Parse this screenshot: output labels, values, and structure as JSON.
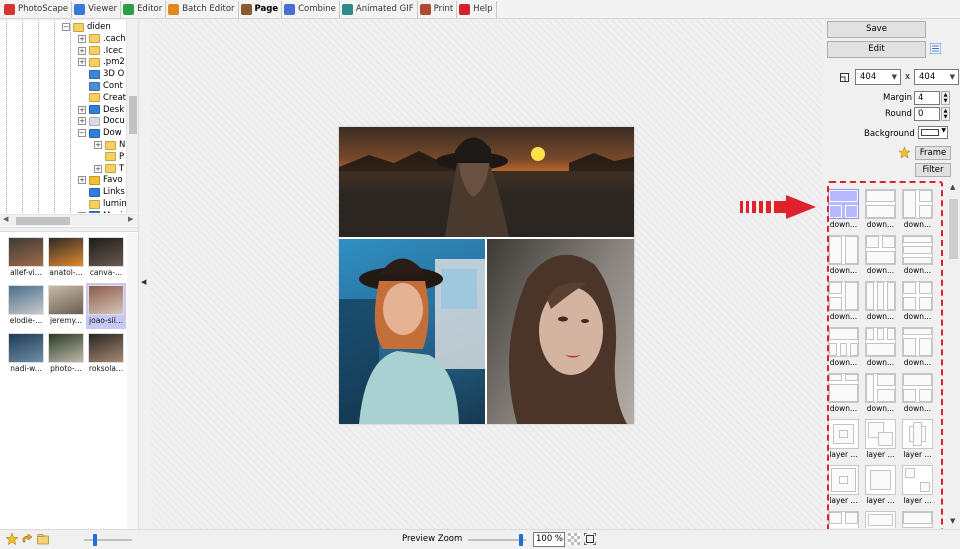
{
  "tabs": [
    {
      "label": "PhotoScape",
      "icon": "photoscape-icon",
      "color": "#d9342b"
    },
    {
      "label": "Viewer",
      "icon": "viewer-icon",
      "color": "#3a7ad6"
    },
    {
      "label": "Editor",
      "icon": "editor-icon",
      "color": "#2e9e45"
    },
    {
      "label": "Batch Editor",
      "icon": "batch-editor-icon",
      "color": "#e08a1e"
    },
    {
      "label": "Page",
      "icon": "page-icon",
      "color": "#8a5a2b",
      "active": true
    },
    {
      "label": "Combine",
      "icon": "combine-icon",
      "color": "#4a6fd1"
    },
    {
      "label": "Animated GIF",
      "icon": "animated-gif-icon",
      "color": "#2b8a8a"
    },
    {
      "label": "Print",
      "icon": "print-icon",
      "color": "#b04a2e"
    },
    {
      "label": "Help",
      "icon": "help-icon",
      "color": "#d3222a"
    }
  ],
  "tree": [
    {
      "label": "diden",
      "expander": "-",
      "indent": 1,
      "icon": "folder-icon",
      "color": "#f6cf5c"
    },
    {
      "label": ".cach",
      "expander": "+",
      "indent": 2,
      "icon": "folder-icon",
      "color": "#f6cf5c"
    },
    {
      "label": ".Icec",
      "expander": "+",
      "indent": 2,
      "icon": "folder-icon",
      "color": "#f6cf5c"
    },
    {
      "label": ".pm2",
      "expander": "+",
      "indent": 2,
      "icon": "folder-icon",
      "color": "#f6cf5c"
    },
    {
      "label": "3D O",
      "expander": "",
      "indent": 2,
      "icon": "3d-objects-icon",
      "color": "#3a86d8"
    },
    {
      "label": "Cont",
      "expander": "",
      "indent": 2,
      "icon": "contacts-icon",
      "color": "#4a8fd6"
    },
    {
      "label": "Creat",
      "expander": "",
      "indent": 2,
      "icon": "folder-icon",
      "color": "#f6cf5c"
    },
    {
      "label": "Desk",
      "expander": "+",
      "indent": 2,
      "icon": "desktop-icon",
      "color": "#2f7fd8"
    },
    {
      "label": "Docu",
      "expander": "+",
      "indent": 2,
      "icon": "documents-icon",
      "color": "#d7dbe3"
    },
    {
      "label": "Dow",
      "expander": "-",
      "indent": 2,
      "icon": "downloads-icon",
      "color": "#2f7fd8"
    },
    {
      "label": "N",
      "expander": "+",
      "indent": 3,
      "icon": "folder-icon",
      "color": "#f6cf5c"
    },
    {
      "label": "P",
      "expander": "",
      "indent": 3,
      "icon": "folder-icon",
      "color": "#f6cf5c"
    },
    {
      "label": "T",
      "expander": "+",
      "indent": 3,
      "icon": "folder-icon",
      "color": "#f6cf5c"
    },
    {
      "label": "Favo",
      "expander": "+",
      "indent": 2,
      "icon": "favorites-icon",
      "color": "#f0c030"
    },
    {
      "label": "Links",
      "expander": "",
      "indent": 2,
      "icon": "links-icon",
      "color": "#2f7fd8"
    },
    {
      "label": "lumin",
      "expander": "",
      "indent": 2,
      "icon": "folder-icon",
      "color": "#f6cf5c"
    },
    {
      "label": "Music",
      "expander": "+",
      "indent": 2,
      "icon": "music-icon",
      "color": "#2f7fd8"
    }
  ],
  "thumbnails": [
    {
      "caption": "allef-vi...",
      "colors": [
        "#3d3a36",
        "#a06a4a"
      ],
      "selected": false
    },
    {
      "caption": "anatol-...",
      "colors": [
        "#2e2a28",
        "#e0892e"
      ],
      "selected": false
    },
    {
      "caption": "canva-...",
      "colors": [
        "#1e1c1b",
        "#6a5a50"
      ],
      "selected": false
    },
    {
      "caption": "elodie-...",
      "colors": [
        "#4a6f8c",
        "#c9c9c9"
      ],
      "selected": false
    },
    {
      "caption": "jeremy...",
      "colors": [
        "#c9b8a8",
        "#6a5e52"
      ],
      "selected": false
    },
    {
      "caption": "joao-sil...",
      "colors": [
        "#8a5c4a",
        "#d6c4ba"
      ],
      "selected": true
    },
    {
      "caption": "nadi-w...",
      "colors": [
        "#203a56",
        "#6d8fa8"
      ],
      "selected": false
    },
    {
      "caption": "photo-...",
      "colors": [
        "#2a3a26",
        "#bfbaaa"
      ],
      "selected": false
    },
    {
      "caption": "roksola...",
      "colors": [
        "#2b2622",
        "#a58a74"
      ],
      "selected": false
    }
  ],
  "right_panel": {
    "save_label": "Save",
    "edit_label": "Edit",
    "width_value": "404",
    "height_value": "404",
    "times_sign": "x",
    "margin_label": "Margin",
    "margin_value": "4",
    "round_label": "Round",
    "round_value": "0",
    "background_label": "Background",
    "background_color": "#ffffff",
    "frame_label": "Frame",
    "filter_label": "Filter"
  },
  "layouts": {
    "selected_index": 0,
    "labels": [
      "down...",
      "down...",
      "down...",
      "down...",
      "down...",
      "down...",
      "down...",
      "down...",
      "down...",
      "down...",
      "down...",
      "down...",
      "down...",
      "down...",
      "down...",
      "layer ...",
      "layer ...",
      "layer ...",
      "layer ...",
      "layer ...",
      "layer ...",
      "",
      "",
      ""
    ]
  },
  "bottom": {
    "preview_zoom_label": "Preview Zoom",
    "zoom_value": "100 %",
    "thumb_size_level": 0.2,
    "preview_zoom_level": 0.95
  },
  "annotation_color": "#e0202a"
}
